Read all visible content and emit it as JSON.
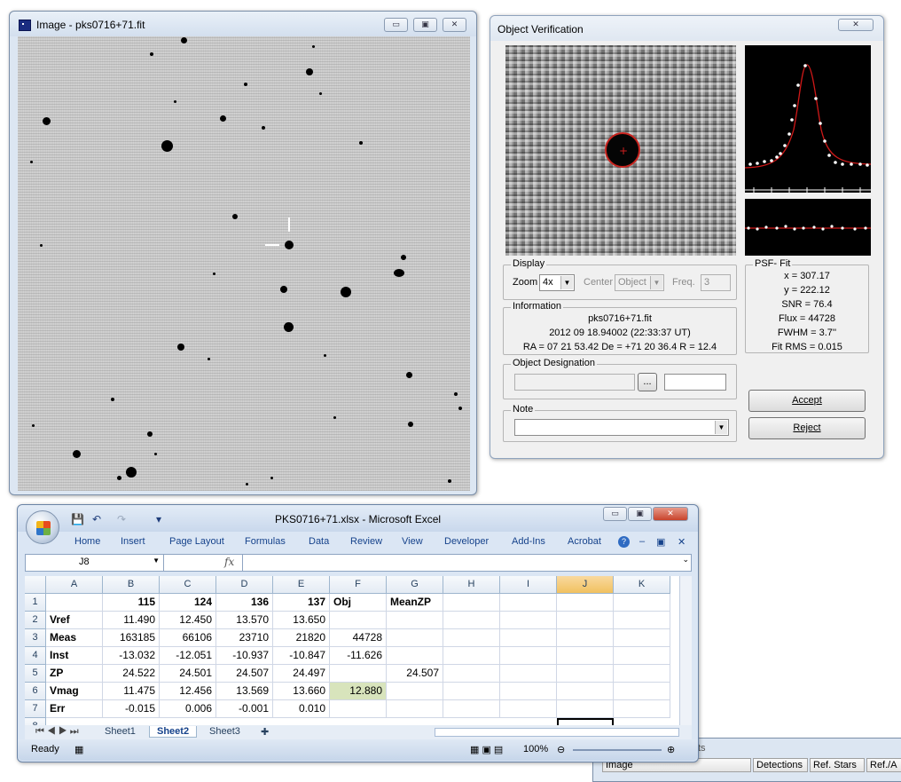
{
  "image_window": {
    "title": "Image - pks0716+71.fit",
    "buttons": {
      "minimize": "▭",
      "maximize": "▣",
      "close": "✕"
    }
  },
  "object_verification": {
    "title": "Object Verification",
    "display": {
      "label": "Display",
      "zoom_label": "Zoom",
      "zoom_value": "4x",
      "center_label": "Center",
      "center_value": "Object",
      "freq_label": "Freq.",
      "freq_value": "3"
    },
    "information": {
      "label": "Information",
      "filename": "pks0716+71.fit",
      "date": "2012 09 18.94002 (22:33:37 UT)",
      "coords": "RA = 07 21 53.42   De = +71 20 36.4   R = 12.4"
    },
    "designation": {
      "label": "Object Designation",
      "browse": "..."
    },
    "note": {
      "label": "Note"
    },
    "psf_fit": {
      "label": "PSF- Fit",
      "x": "x = 307.17",
      "y": "y = 222.12",
      "snr": "SNR = 76.4",
      "flux": "Flux = 44728",
      "fwhm": "FWHM = 3.7''",
      "fit_rms": "Fit RMS = 0.015"
    },
    "accept_label": "Accept",
    "reject_label": "Reject",
    "close": "✕"
  },
  "excel": {
    "title": "PKS0716+71.xlsx - Microsoft Excel",
    "tabs": [
      "Home",
      "Insert",
      "Page Layout",
      "Formulas",
      "Data",
      "Review",
      "View",
      "Developer",
      "Add-Ins",
      "Acrobat"
    ],
    "name_box": "J8",
    "fx": "fx",
    "col_headers": [
      "A",
      "B",
      "C",
      "D",
      "E",
      "F",
      "G",
      "H",
      "I",
      "J",
      "K"
    ],
    "rows": [
      {
        "n": "1",
        "cells": [
          "",
          "115",
          "124",
          "136",
          "137",
          "Obj",
          "MeanZP",
          "",
          "",
          "",
          ""
        ]
      },
      {
        "n": "2",
        "cells": [
          "Vref",
          "11.490",
          "12.450",
          "13.570",
          "13.650",
          "",
          "",
          "",
          "",
          "",
          ""
        ]
      },
      {
        "n": "3",
        "cells": [
          "Meas",
          "163185",
          "66106",
          "23710",
          "21820",
          "44728",
          "",
          "",
          "",
          "",
          ""
        ]
      },
      {
        "n": "4",
        "cells": [
          "Inst",
          "-13.032",
          "-12.051",
          "-10.937",
          "-10.847",
          "-11.626",
          "",
          "",
          "",
          "",
          ""
        ]
      },
      {
        "n": "5",
        "cells": [
          "ZP",
          "24.522",
          "24.501",
          "24.507",
          "24.497",
          "",
          "24.507",
          "",
          "",
          "",
          ""
        ]
      },
      {
        "n": "6",
        "cells": [
          "Vmag",
          "11.475",
          "12.456",
          "13.569",
          "13.660",
          "12.880",
          "",
          "",
          "",
          "",
          ""
        ]
      },
      {
        "n": "7",
        "cells": [
          "Err",
          "-0.015",
          "0.006",
          "-0.001",
          "0.010",
          "",
          "",
          "",
          "",
          "",
          ""
        ]
      }
    ],
    "sheets": [
      "Sheet1",
      "Sheet2",
      "Sheet3"
    ],
    "active_sheet": "Sheet2",
    "status": "Ready",
    "zoom": "100%"
  },
  "background_window": {
    "columns": [
      "Image",
      "Detections",
      "Ref. Stars",
      "Ref./A"
    ],
    "partial_title": "ts"
  },
  "colors": {
    "highlight_cell": "#d8e4bc",
    "fit_curve": "#d01818",
    "selected_column": "#f1c15f"
  }
}
